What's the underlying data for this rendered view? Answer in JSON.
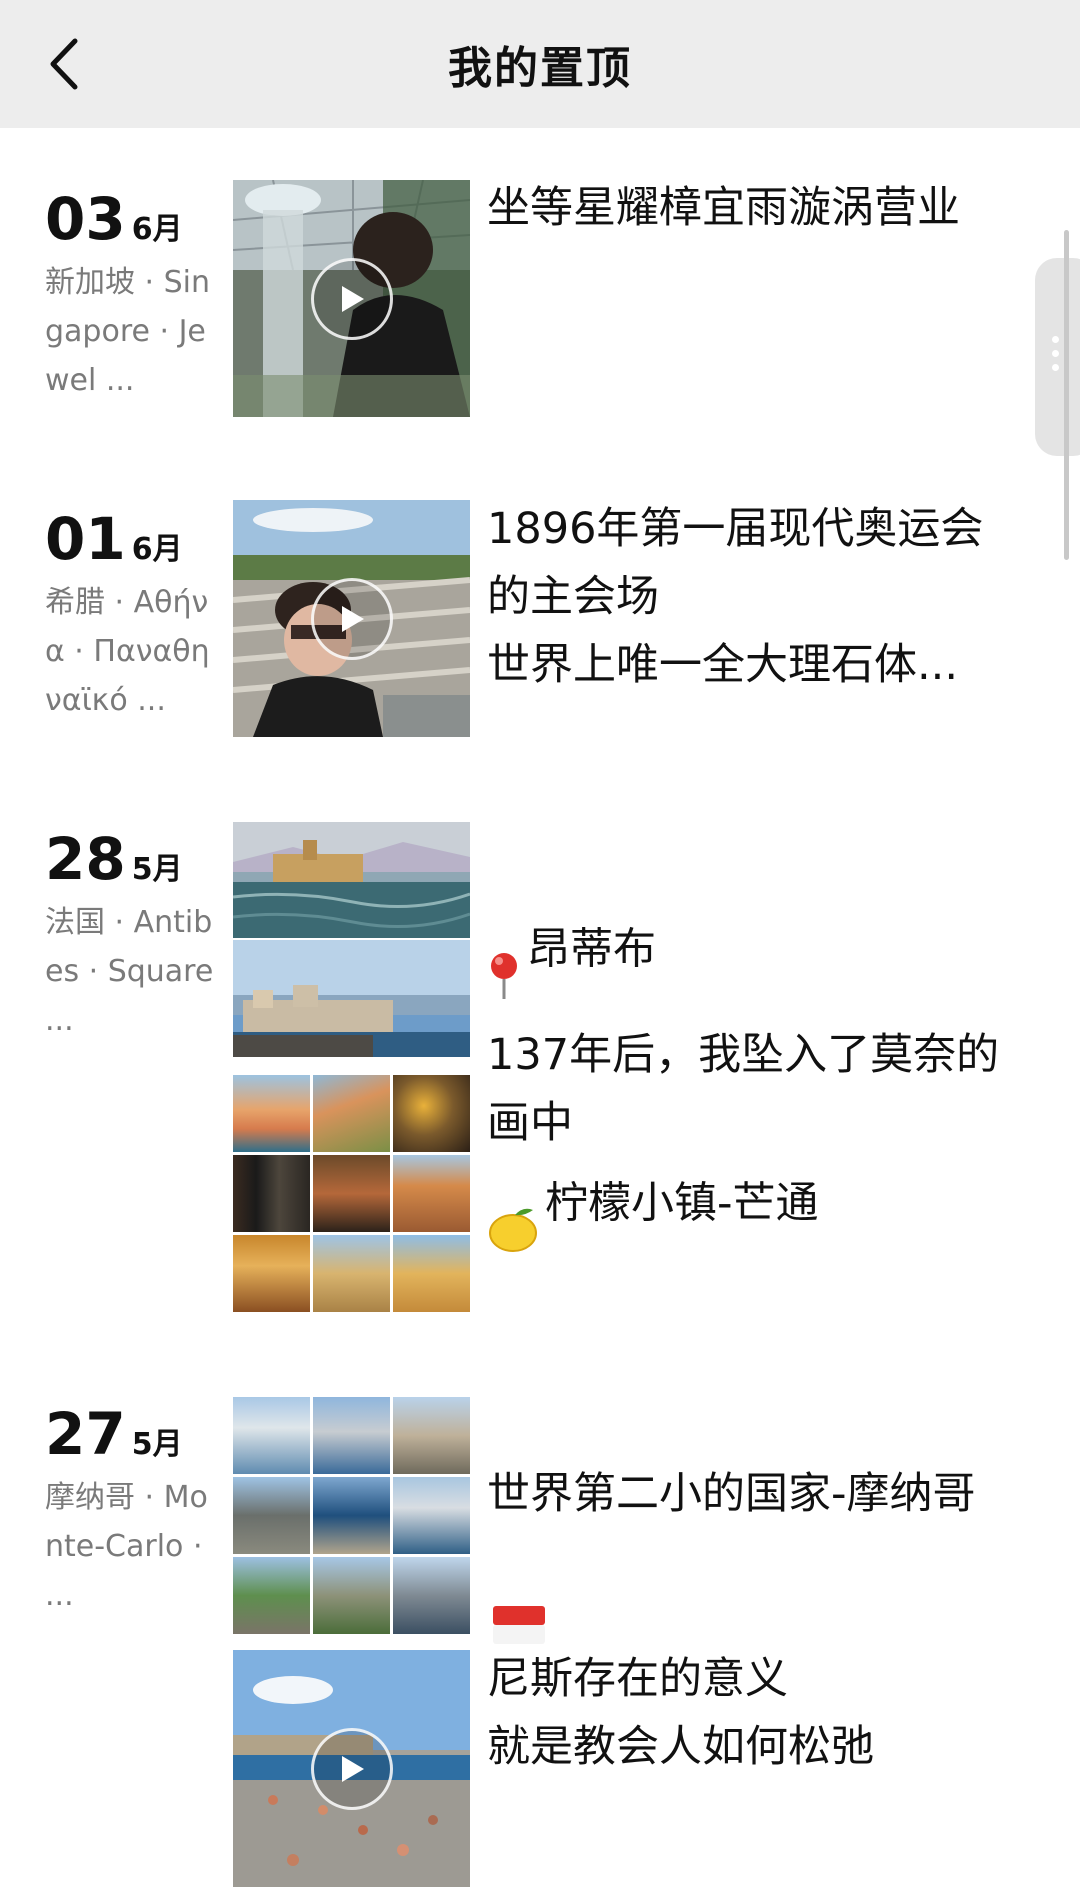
{
  "nav": {
    "title": "我的置顶",
    "back_icon": "chevron-left-icon"
  },
  "posts": [
    {
      "day": "03",
      "month": "6月",
      "location": "新加坡 · Singapore · Jewel ...",
      "text": "坐等星耀樟宜雨漩涡营业",
      "media": "video"
    },
    {
      "day": "01",
      "month": "6月",
      "location": "希腊 · Αθήνα · Παναθηναϊκό ...",
      "text": "1896年第一届现代奥运会的主会场\n世界上唯一全大理石体...",
      "media": "video"
    },
    {
      "day": "28",
      "month": "5月",
      "location": "法国 · Antibes · Square ...",
      "text": "昂蒂布\n137年后，我坠入了莫奈的画中",
      "media": "two-photos",
      "icon": "red-pin-icon"
    },
    {
      "day": "",
      "month": "",
      "location": "",
      "text": "柠檬小镇-芒通",
      "media": "photo-grid-9",
      "icon": "lemon-icon"
    },
    {
      "day": "27",
      "month": "5月",
      "location": "摩纳哥 · Monte-Carlo · ...",
      "text": "世界第二小的国家-摩纳哥",
      "media": "photo-grid-9",
      "icon": "monaco-flag-icon"
    },
    {
      "day": "",
      "month": "",
      "location": "",
      "text": "尼斯存在的意义\n就是教会人如何松弛",
      "media": "video"
    }
  ],
  "colors": {
    "navbar_bg": "#ededed",
    "secondary_text": "#7a7a7a"
  }
}
